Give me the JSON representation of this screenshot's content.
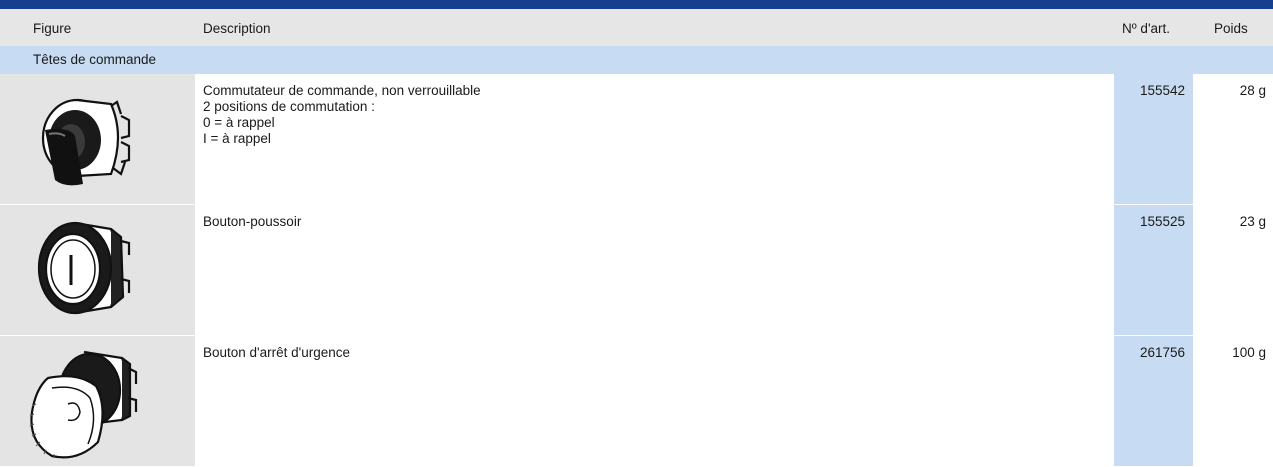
{
  "header": {
    "figure": "Figure",
    "description": "Description",
    "article_no": "Nº d'art.",
    "weight": "Poids"
  },
  "category": "Têtes de commande",
  "rows": [
    {
      "icon": "rotary-selector-switch-icon",
      "description_lines": [
        "Commutateur de commande, non verrouillable",
        "2 positions de commutation :",
        "0 = à rappel",
        "I = à rappel"
      ],
      "article_no": "155542",
      "weight": "28 g"
    },
    {
      "icon": "push-button-icon",
      "description_lines": [
        "Bouton-poussoir"
      ],
      "article_no": "155525",
      "weight": "23 g"
    },
    {
      "icon": "emergency-stop-button-icon",
      "description_lines": [
        "Bouton d'arrêt d'urgence"
      ],
      "article_no": "261756",
      "weight": "100 g"
    }
  ],
  "colors": {
    "top_bar": "#163f8f",
    "header_bg": "#e6e6e6",
    "category_bg": "#c7dcf2",
    "figure_bg": "#e4e4e4",
    "article_bg": "#c7dcf2"
  }
}
